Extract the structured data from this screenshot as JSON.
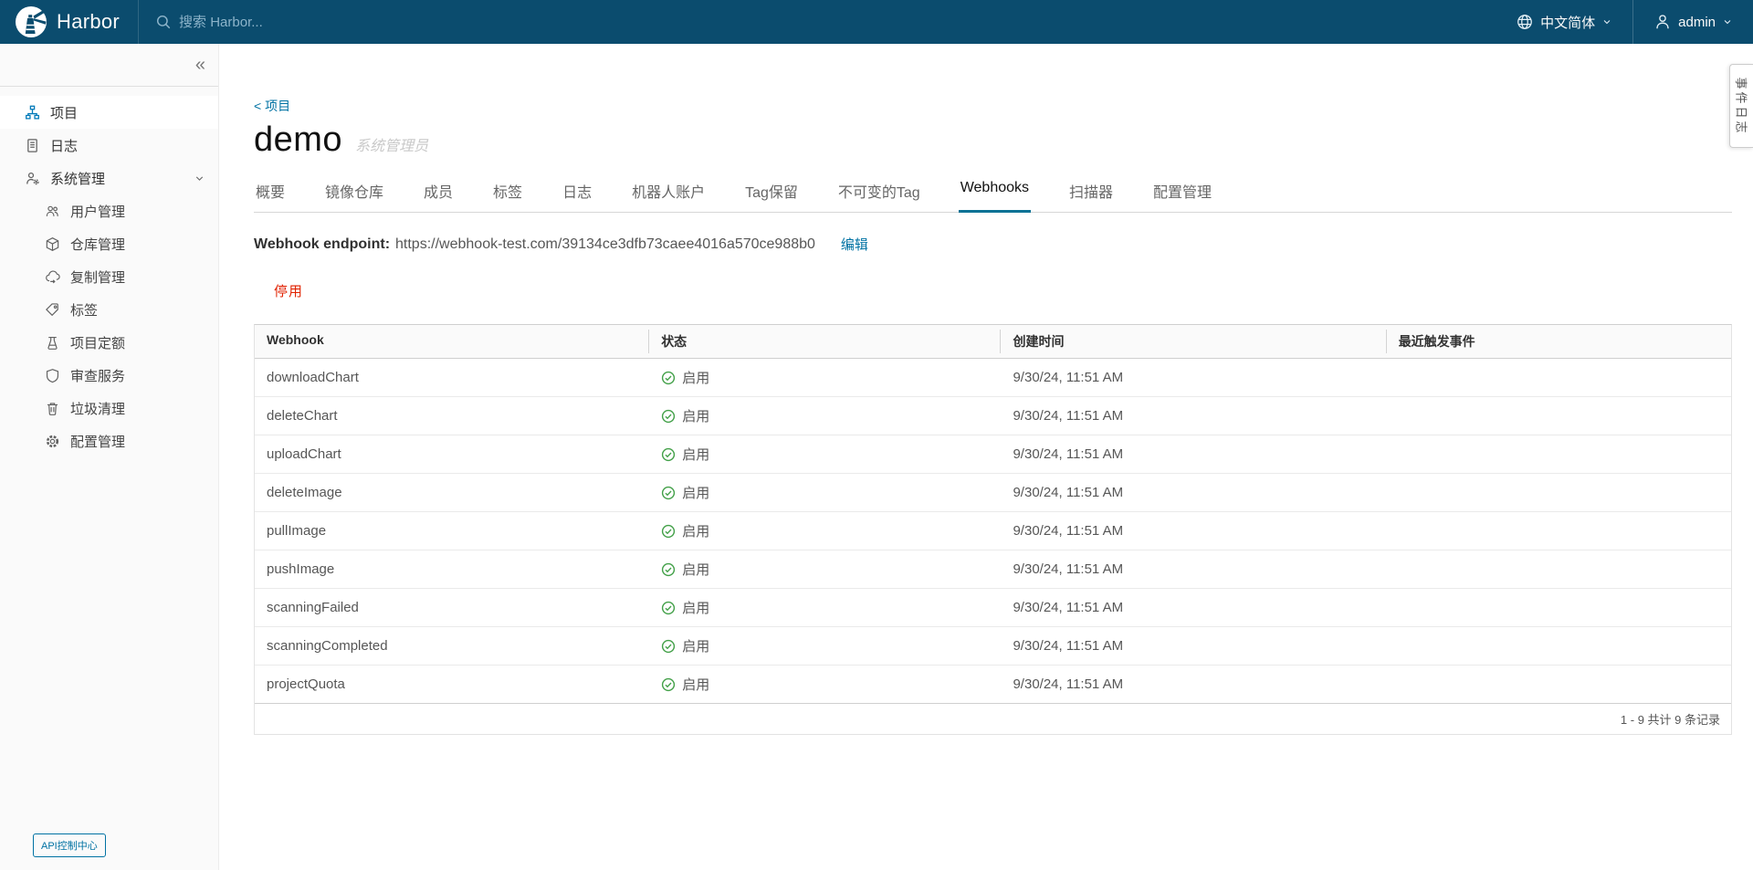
{
  "colors": {
    "header_bg": "#0b4c6e",
    "accent": "#0072a3",
    "danger": "#e12200",
    "success": "#42a048"
  },
  "header": {
    "brand": "Harbor",
    "logo_icon": "harbor-lighthouse-icon",
    "search_icon": "search-icon",
    "search_placeholder": "搜索 Harbor...",
    "language_icon": "globe-icon",
    "language": "中文简体",
    "user_icon": "person-icon",
    "user": "admin"
  },
  "sidebar": {
    "collapse_glyph": "«",
    "items": [
      {
        "label": "项目",
        "icon": "projects-icon",
        "active": true
      },
      {
        "label": "日志",
        "icon": "logs-icon"
      },
      {
        "label": "系统管理",
        "icon": "administrator-icon",
        "expanded": true
      }
    ],
    "admin_children": [
      {
        "label": "用户管理",
        "icon": "users-icon"
      },
      {
        "label": "仓库管理",
        "icon": "cube-icon"
      },
      {
        "label": "复制管理",
        "icon": "cloud-icon"
      },
      {
        "label": "标签",
        "icon": "tag-icon"
      },
      {
        "label": "项目定额",
        "icon": "quota-icon"
      },
      {
        "label": "审查服务",
        "icon": "shield-icon"
      },
      {
        "label": "垃圾清理",
        "icon": "trash-icon"
      },
      {
        "label": "配置管理",
        "icon": "gear-icon"
      }
    ],
    "api_button_label": "API控制中心"
  },
  "page": {
    "breadcrumb": "< 项目",
    "title": "demo",
    "subtitle": "系统管理员"
  },
  "tabs": {
    "active": "Webhooks",
    "items": [
      "概要",
      "镜像仓库",
      "成员",
      "标签",
      "日志",
      "机器人账户",
      "Tag保留",
      "不可变的Tag",
      "Webhooks",
      "扫描器",
      "配置管理"
    ]
  },
  "webhook": {
    "endpoint_label": "Webhook endpoint:",
    "endpoint_url": "https://webhook-test.com/39134ce3dfb73caee4016a570ce988b0",
    "edit_label": "编辑",
    "disable_label": "停用"
  },
  "table": {
    "columns": [
      "Webhook",
      "状态",
      "创建时间",
      "最近触发事件"
    ],
    "rows": [
      {
        "webhook": "downloadChart",
        "status": "启用",
        "created": "9/30/24, 11:51 AM",
        "last_event": ""
      },
      {
        "webhook": "deleteChart",
        "status": "启用",
        "created": "9/30/24, 11:51 AM",
        "last_event": ""
      },
      {
        "webhook": "uploadChart",
        "status": "启用",
        "created": "9/30/24, 11:51 AM",
        "last_event": ""
      },
      {
        "webhook": "deleteImage",
        "status": "启用",
        "created": "9/30/24, 11:51 AM",
        "last_event": ""
      },
      {
        "webhook": "pullImage",
        "status": "启用",
        "created": "9/30/24, 11:51 AM",
        "last_event": ""
      },
      {
        "webhook": "pushImage",
        "status": "启用",
        "created": "9/30/24, 11:51 AM",
        "last_event": ""
      },
      {
        "webhook": "scanningFailed",
        "status": "启用",
        "created": "9/30/24, 11:51 AM",
        "last_event": ""
      },
      {
        "webhook": "scanningCompleted",
        "status": "启用",
        "created": "9/30/24, 11:51 AM",
        "last_event": ""
      },
      {
        "webhook": "projectQuota",
        "status": "启用",
        "created": "9/30/24, 11:51 AM",
        "last_event": ""
      }
    ],
    "status_icon": "check-circle-icon",
    "pagination": "1 - 9 共计 9 条记录"
  },
  "side_tab": {
    "text": "事件日志"
  }
}
